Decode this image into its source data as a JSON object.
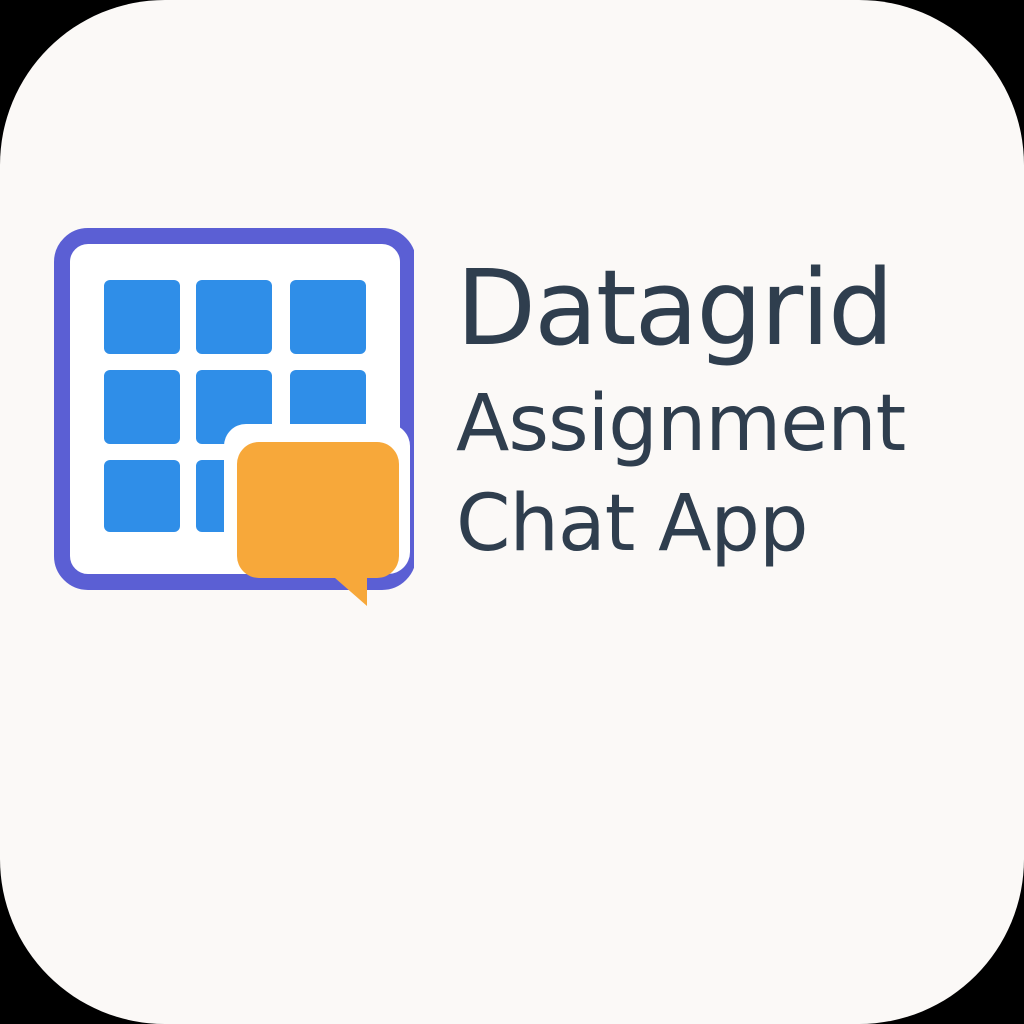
{
  "app_icon": {
    "title_lines": [
      "Datagrid",
      "Assignment",
      "Chat App"
    ],
    "logo": {
      "icon_name": "datagrid-chat-logo-icon",
      "frame_color": "#5b5fd4",
      "cell_color": "#2f8ee8",
      "bubble_color": "#f7a83a"
    },
    "colors": {
      "background": "#fbf9f7",
      "text": "#2f3e4e"
    }
  }
}
